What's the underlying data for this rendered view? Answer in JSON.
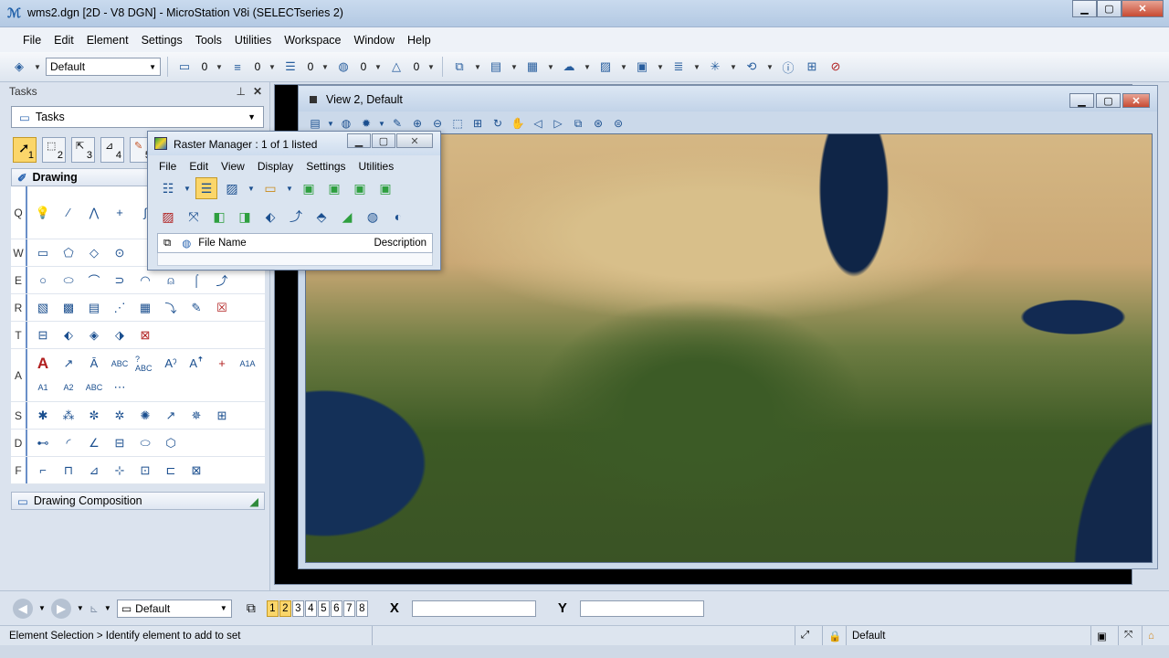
{
  "window": {
    "title": "wms2.dgn [2D - V8 DGN] - MicroStation V8i (SELECTseries 2)"
  },
  "menu": [
    "File",
    "Edit",
    "Element",
    "Settings",
    "Tools",
    "Utilities",
    "Workspace",
    "Window",
    "Help"
  ],
  "toolbar": {
    "level": "Default",
    "color_value": "0",
    "style_value": "0",
    "weight_value": "0",
    "transparency_value": "0",
    "priority_value": "0"
  },
  "tasks": {
    "header": "Tasks",
    "selected_task": "Tasks",
    "quick_numbers": [
      "1",
      "2",
      "3",
      "4",
      "5"
    ],
    "section_title": "Drawing",
    "row_letters": [
      "Q",
      "W",
      "E",
      "R",
      "T",
      "A",
      "S",
      "D",
      "F"
    ],
    "footer_section": "Drawing Composition"
  },
  "view2": {
    "title": "View 2, Default"
  },
  "raster_manager": {
    "title": "Raster Manager : 1 of 1 listed",
    "menu": [
      "File",
      "Edit",
      "View",
      "Display",
      "Settings",
      "Utilities"
    ],
    "col_filename": "File Name",
    "col_description": "Description"
  },
  "bottom": {
    "level": "Default",
    "views": [
      "1",
      "2",
      "3",
      "4",
      "5",
      "6",
      "7",
      "8"
    ],
    "x_label": "X",
    "y_label": "Y"
  },
  "status": {
    "message": "Element Selection > Identify element to add to set",
    "active_level": "Default"
  },
  "colors": {
    "accent_yellow": "#fbd66a",
    "titlebar_blue": "#c9daee"
  }
}
